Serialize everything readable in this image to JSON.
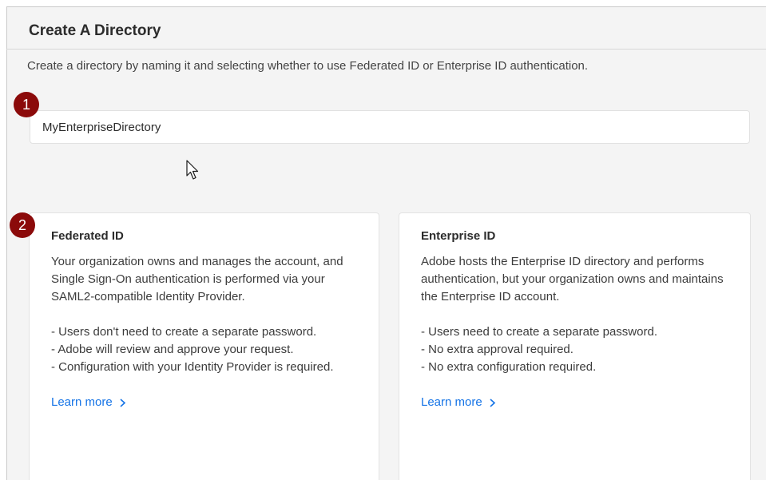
{
  "page": {
    "title": "Create A Directory",
    "description": "Create a directory by naming it and selecting whether to use Federated ID or Enterprise ID authentication."
  },
  "steps": {
    "one": "1",
    "two": "2"
  },
  "directory_name": {
    "value": "MyEnterpriseDirectory"
  },
  "options": [
    {
      "title": "Federated ID",
      "description": "Your organization owns and manages the account, and Single Sign-On authentication is performed via your SAML2-compatible Identity Provider.",
      "points": [
        "- Users don't need to create a separate password.",
        "- Adobe will review and approve your request.",
        "- Configuration with your Identity Provider is required."
      ],
      "link_label": "Learn more"
    },
    {
      "title": "Enterprise ID",
      "description": "Adobe hosts the Enterprise ID directory and performs authentication, but your organization owns and maintains the Enterprise ID account.",
      "points": [
        "- Users need to create a separate password.",
        "- No extra approval required.",
        "- No extra configuration required."
      ],
      "link_label": "Learn more"
    }
  ],
  "colors": {
    "badge": "#8b0a0a",
    "link": "#1473e6",
    "panel_background": "#f4f4f4"
  },
  "icons": {
    "cursor": "mouse-pointer-icon",
    "link_chevron": "chevron-right-icon"
  }
}
